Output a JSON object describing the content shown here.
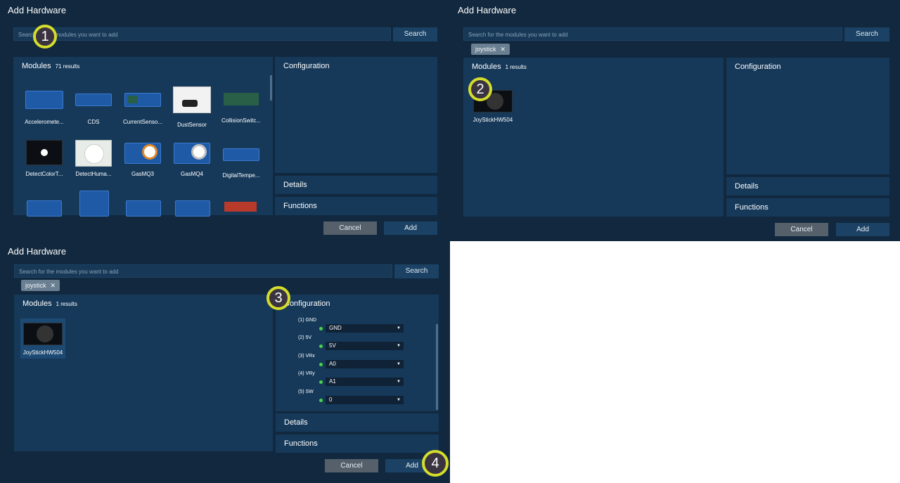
{
  "dialogs": [
    {
      "title": "Add Hardware",
      "search": {
        "placeholder": "Search for the modules you want to add",
        "button": "Search"
      },
      "modules": {
        "title": "Modules",
        "count": "71 results",
        "items": [
          {
            "label": "Acceleromete...",
            "icon": "accelerometer-board-icon"
          },
          {
            "label": "CDS",
            "icon": "cds-board-icon"
          },
          {
            "label": "CurrentSenso...",
            "icon": "current-sensor-board-icon"
          },
          {
            "label": "DustSensor",
            "icon": "dust-sensor-icon"
          },
          {
            "label": "CollisionSwitc...",
            "icon": "collision-switch-icon"
          },
          {
            "label": "DetectColorT...",
            "icon": "color-sensor-icon"
          },
          {
            "label": "DetectHuma...",
            "icon": "pir-sensor-icon"
          },
          {
            "label": "GasMQ3",
            "icon": "gas-sensor-icon"
          },
          {
            "label": "GasMQ4",
            "icon": "gas-sensor-icon"
          },
          {
            "label": "DigitalTempe...",
            "icon": "digital-temperature-icon"
          }
        ]
      },
      "sections": {
        "configuration": "Configuration",
        "details": "Details",
        "functions": "Functions"
      },
      "buttons": {
        "cancel": "Cancel",
        "add": "Add"
      },
      "marker": "1"
    },
    {
      "title": "Add Hardware",
      "search": {
        "placeholder": "Search for the modules you want to add",
        "button": "Search"
      },
      "chip": "joystick",
      "modules": {
        "title": "Modules",
        "count": "1 results",
        "items": [
          {
            "label": "JoyStickHW504",
            "icon": "joystick-module-icon"
          }
        ]
      },
      "sections": {
        "configuration": "Configuration",
        "details": "Details",
        "functions": "Functions"
      },
      "buttons": {
        "cancel": "Cancel",
        "add": "Add"
      },
      "marker": "2"
    },
    {
      "title": "Add Hardware",
      "search": {
        "placeholder": "Search for the modules you want to add",
        "button": "Search"
      },
      "chip": "joystick",
      "modules": {
        "title": "Modules",
        "count": "1 results",
        "items": [
          {
            "label": "JoyStickHW504",
            "icon": "joystick-module-icon"
          }
        ]
      },
      "sections": {
        "configuration": "Configuration",
        "details": "Details",
        "functions": "Functions"
      },
      "config": [
        {
          "pin": "(1) GND",
          "value": "GND"
        },
        {
          "pin": "(2) 5V",
          "value": "5V"
        },
        {
          "pin": "(3) VRx",
          "value": "A0"
        },
        {
          "pin": "(4) VRy",
          "value": "A1"
        },
        {
          "pin": "(5) SW",
          "value": "0"
        }
      ],
      "buttons": {
        "cancel": "Cancel",
        "add": "Add"
      },
      "markers": [
        "3",
        "4"
      ]
    }
  ],
  "colors": {
    "dialog_bg": "#11283e",
    "box_bg": "#16395a",
    "accent_marker": "#d4dc2c",
    "status_dot": "#4cd14c"
  }
}
